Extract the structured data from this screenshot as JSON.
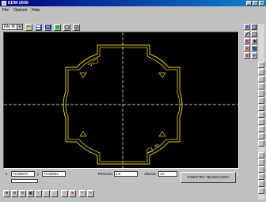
{
  "window": {
    "title": "EDM 2000"
  },
  "titlebar": {
    "minimize": "_",
    "maximize": "□",
    "close": "×"
  },
  "menu": [
    "File",
    "Opzioni",
    "Help"
  ],
  "toolbar": {
    "file_select": "File M"
  },
  "status": {
    "x_label": "x",
    "x_value": "70.56979",
    "y_label": "y",
    "y_value": "70.56932",
    "percorso_label": "Percorso",
    "percorso_value": "1.0",
    "altezza_label": "Altezza",
    "altezza_value": "10",
    "finestra_button": "FINESTRA TECNOLOGIA"
  },
  "colors": {
    "profile": "#e6d21e",
    "axis": "#ffffff",
    "canvas": "#000000",
    "title": "#000080"
  }
}
